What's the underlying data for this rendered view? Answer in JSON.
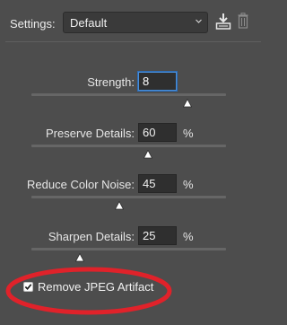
{
  "header": {
    "settings_label": "Settings:",
    "preset_value": "Default",
    "save_icon": "save-preset-icon",
    "delete_icon": "trash-icon"
  },
  "sliders": [
    {
      "label": "Strength:",
      "value": "8",
      "unit": "",
      "level": 0.8
    },
    {
      "label": "Preserve Details:",
      "value": "60",
      "unit": "%",
      "level": 0.6
    },
    {
      "label": "Reduce Color Noise:",
      "value": "45",
      "unit": "%",
      "level": 0.45
    },
    {
      "label": "Sharpen Details:",
      "value": "25",
      "unit": "%",
      "level": 0.25
    }
  ],
  "jpeg": {
    "label": "Remove JPEG Artifact",
    "checked": true
  },
  "colors": {
    "panel_bg": "#4d4d4d",
    "field_bg": "#2f2f2f",
    "focus_ring": "#4a8fd9",
    "highlight_annotation": "#e0222a"
  }
}
